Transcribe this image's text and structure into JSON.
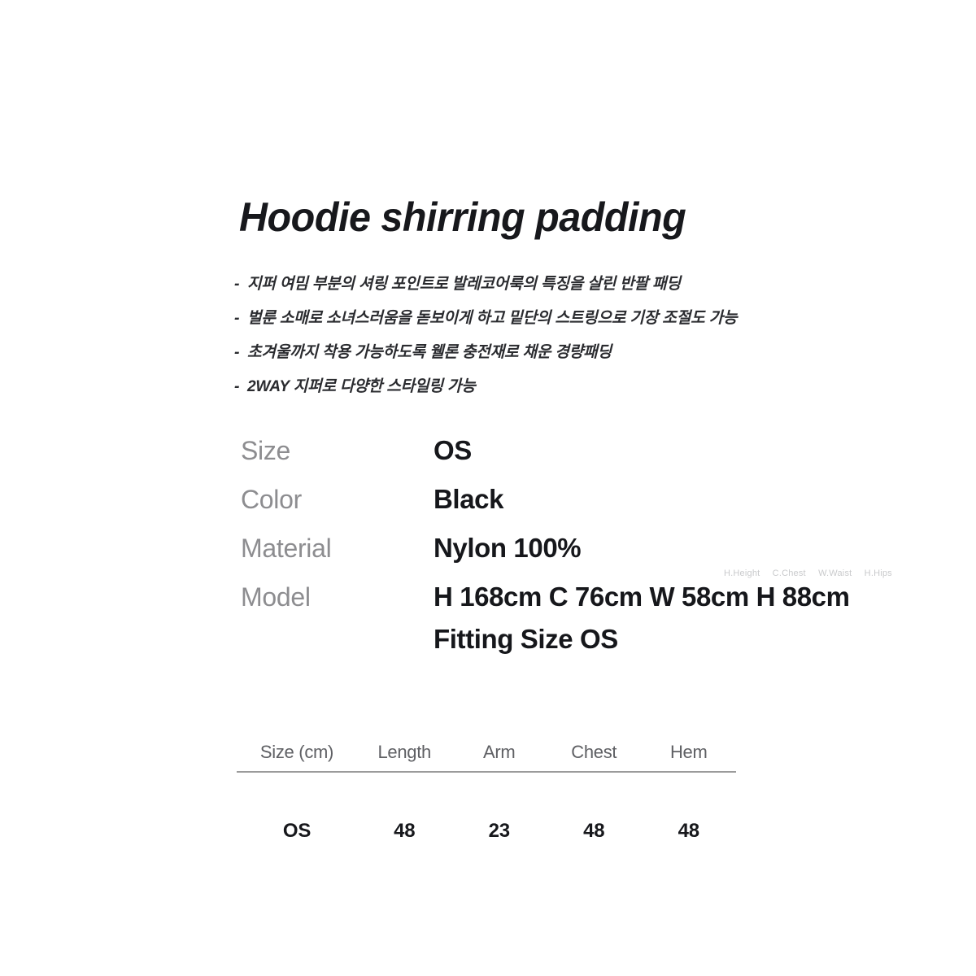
{
  "product": {
    "title": "Hoodie shirring padding",
    "features": [
      {
        "marker": "-",
        "text": "지퍼 여밈 부분의 셔링 포인트로 발레코어룩의 특징을 살린 반팔 패딩"
      },
      {
        "marker": "-",
        "text": "벌룬 소매로 소녀스러움을 돋보이게 하고 밑단의 스트링으로 기장 조절도 가능"
      },
      {
        "marker": "-",
        "text": "초겨울까지 착용 가능하도록 웰론 충전재로 채운 경량패딩"
      },
      {
        "marker": "-",
        "text": "2WAY 지퍼로 다양한 스타일링 가능"
      }
    ]
  },
  "specs": [
    {
      "label": "Size",
      "value": "OS"
    },
    {
      "label": "Color",
      "value": "Black"
    },
    {
      "label": "Material",
      "value": "Nylon 100%"
    },
    {
      "label": "Model",
      "value": "H 168cm C 76cm W 58cm H 88cm",
      "value_line2": "Fitting Size OS"
    }
  ],
  "model_legend": [
    "H.Height",
    "C.Chest",
    "W.Waist",
    "H.Hips"
  ],
  "size_chart": {
    "headers": [
      "Size (cm)",
      "Length",
      "Arm",
      "Chest",
      "Hem"
    ],
    "rows": [
      [
        "OS",
        "48",
        "23",
        "48",
        "48"
      ]
    ]
  },
  "colors": {
    "background": "#ffffff",
    "title": "#17181c",
    "body": "#2a2b2f",
    "label_gray": "#8d8d90",
    "header_gray": "#5f6064",
    "legend_gray": "#c9cacc",
    "divider": "#9b9b9b"
  }
}
